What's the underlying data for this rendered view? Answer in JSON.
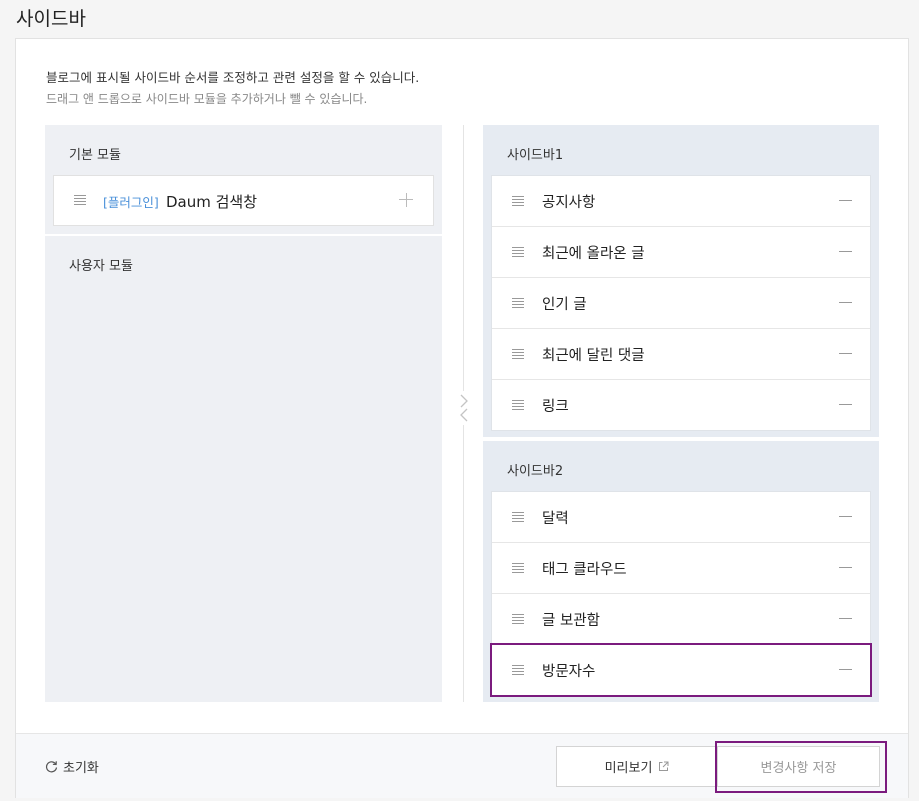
{
  "page": {
    "title": "사이드바"
  },
  "description": {
    "line1": "블로그에 표시될 사이드바 순서를 조정하고 관련 설정을 할 수 있습니다.",
    "line2": "드래그 앤 드롭으로 사이드바 모듈을 추가하거나 뺄 수 있습니다."
  },
  "modules": {
    "basic_title": "기본 모듈",
    "basic_items": [
      {
        "tag": "[플러그인]",
        "name": "Daum 검색창"
      }
    ],
    "user_title": "사용자 모듈"
  },
  "sidebars": [
    {
      "title": "사이드바1",
      "items": [
        "공지사항",
        "최근에 올라온 글",
        "인기 글",
        "최근에 달린 댓글",
        "링크"
      ]
    },
    {
      "title": "사이드바2",
      "items": [
        "달력",
        "태그 클라우드",
        "글 보관함",
        "방문자수"
      ]
    }
  ],
  "footer": {
    "reset_label": "초기화",
    "preview_label": "미리보기",
    "save_label": "변경사항 저장"
  }
}
